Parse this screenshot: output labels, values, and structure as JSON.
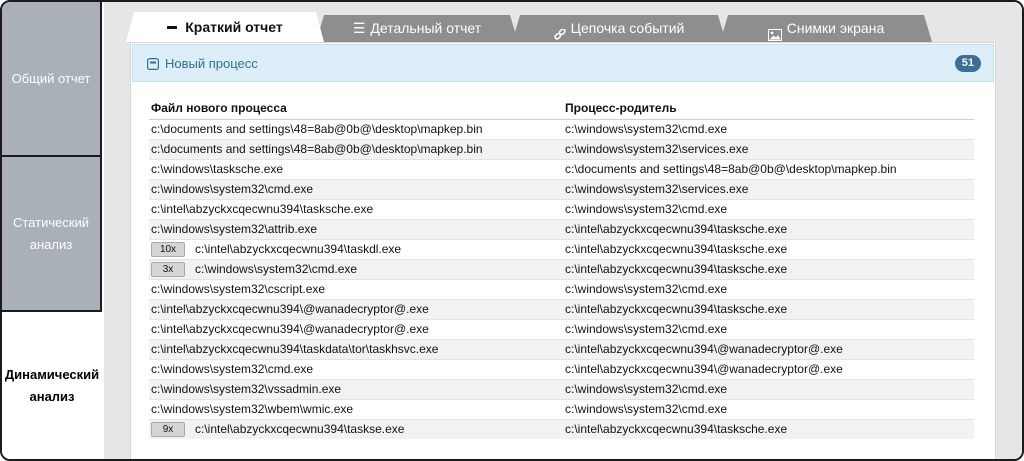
{
  "sidebar": {
    "items": [
      {
        "label": "Общий отчет"
      },
      {
        "label": "Статический анализ"
      },
      {
        "label": "Динамический анализ"
      }
    ]
  },
  "tabs": [
    {
      "label": "Краткий отчет",
      "icon": "minus-icon"
    },
    {
      "label": "Детальный отчет",
      "icon": "list-icon"
    },
    {
      "label": "Цепочка событий",
      "icon": "link-icon"
    },
    {
      "label": "Снимки экрана",
      "icon": "image-icon"
    }
  ],
  "panel": {
    "title": "Новый процесс",
    "badge": "51",
    "columns": [
      "Файл нового процесса",
      "Процесс-родитель"
    ],
    "rows": [
      {
        "count": "",
        "file": "c:\\documents and settings\\48=8ab@0b@\\desktop\\mapkep.bin",
        "parent": "c:\\windows\\system32\\cmd.exe"
      },
      {
        "count": "",
        "file": "c:\\documents and settings\\48=8ab@0b@\\desktop\\mapkep.bin",
        "parent": "c:\\windows\\system32\\services.exe"
      },
      {
        "count": "",
        "file": "c:\\windows\\tasksche.exe",
        "parent": "c:\\documents and settings\\48=8ab@0b@\\desktop\\mapkep.bin"
      },
      {
        "count": "",
        "file": "c:\\windows\\system32\\cmd.exe",
        "parent": "c:\\windows\\system32\\services.exe"
      },
      {
        "count": "",
        "file": "c:\\intel\\abzyckxcqecwnu394\\tasksche.exe",
        "parent": "c:\\windows\\system32\\cmd.exe"
      },
      {
        "count": "",
        "file": "c:\\windows\\system32\\attrib.exe",
        "parent": "c:\\intel\\abzyckxcqecwnu394\\tasksche.exe"
      },
      {
        "count": "10x",
        "file": "c:\\intel\\abzyckxcqecwnu394\\taskdl.exe",
        "parent": "c:\\intel\\abzyckxcqecwnu394\\tasksche.exe"
      },
      {
        "count": "3x",
        "file": "c:\\windows\\system32\\cmd.exe",
        "parent": "c:\\intel\\abzyckxcqecwnu394\\tasksche.exe"
      },
      {
        "count": "",
        "file": "c:\\windows\\system32\\cscript.exe",
        "parent": "c:\\windows\\system32\\cmd.exe"
      },
      {
        "count": "",
        "file": "c:\\intel\\abzyckxcqecwnu394\\@wanadecryptor@.exe",
        "parent": "c:\\intel\\abzyckxcqecwnu394\\tasksche.exe"
      },
      {
        "count": "",
        "file": "c:\\intel\\abzyckxcqecwnu394\\@wanadecryptor@.exe",
        "parent": "c:\\windows\\system32\\cmd.exe"
      },
      {
        "count": "",
        "file": "c:\\intel\\abzyckxcqecwnu394\\taskdata\\tor\\taskhsvc.exe",
        "parent": "c:\\intel\\abzyckxcqecwnu394\\@wanadecryptor@.exe"
      },
      {
        "count": "",
        "file": "c:\\windows\\system32\\cmd.exe",
        "parent": "c:\\intel\\abzyckxcqecwnu394\\@wanadecryptor@.exe"
      },
      {
        "count": "",
        "file": "c:\\windows\\system32\\vssadmin.exe",
        "parent": "c:\\windows\\system32\\cmd.exe"
      },
      {
        "count": "",
        "file": "c:\\windows\\system32\\wbem\\wmic.exe",
        "parent": "c:\\windows\\system32\\cmd.exe"
      },
      {
        "count": "9x",
        "file": "c:\\intel\\abzyckxcqecwnu394\\taskse.exe",
        "parent": "c:\\intel\\abzyckxcqecwnu394\\tasksche.exe"
      }
    ]
  },
  "colors": {
    "accent": "#3a7096",
    "sidebar_inactive": "#a9b0b8",
    "tab_inactive": "#8e8e8e",
    "panel_header": "#dceff8"
  }
}
